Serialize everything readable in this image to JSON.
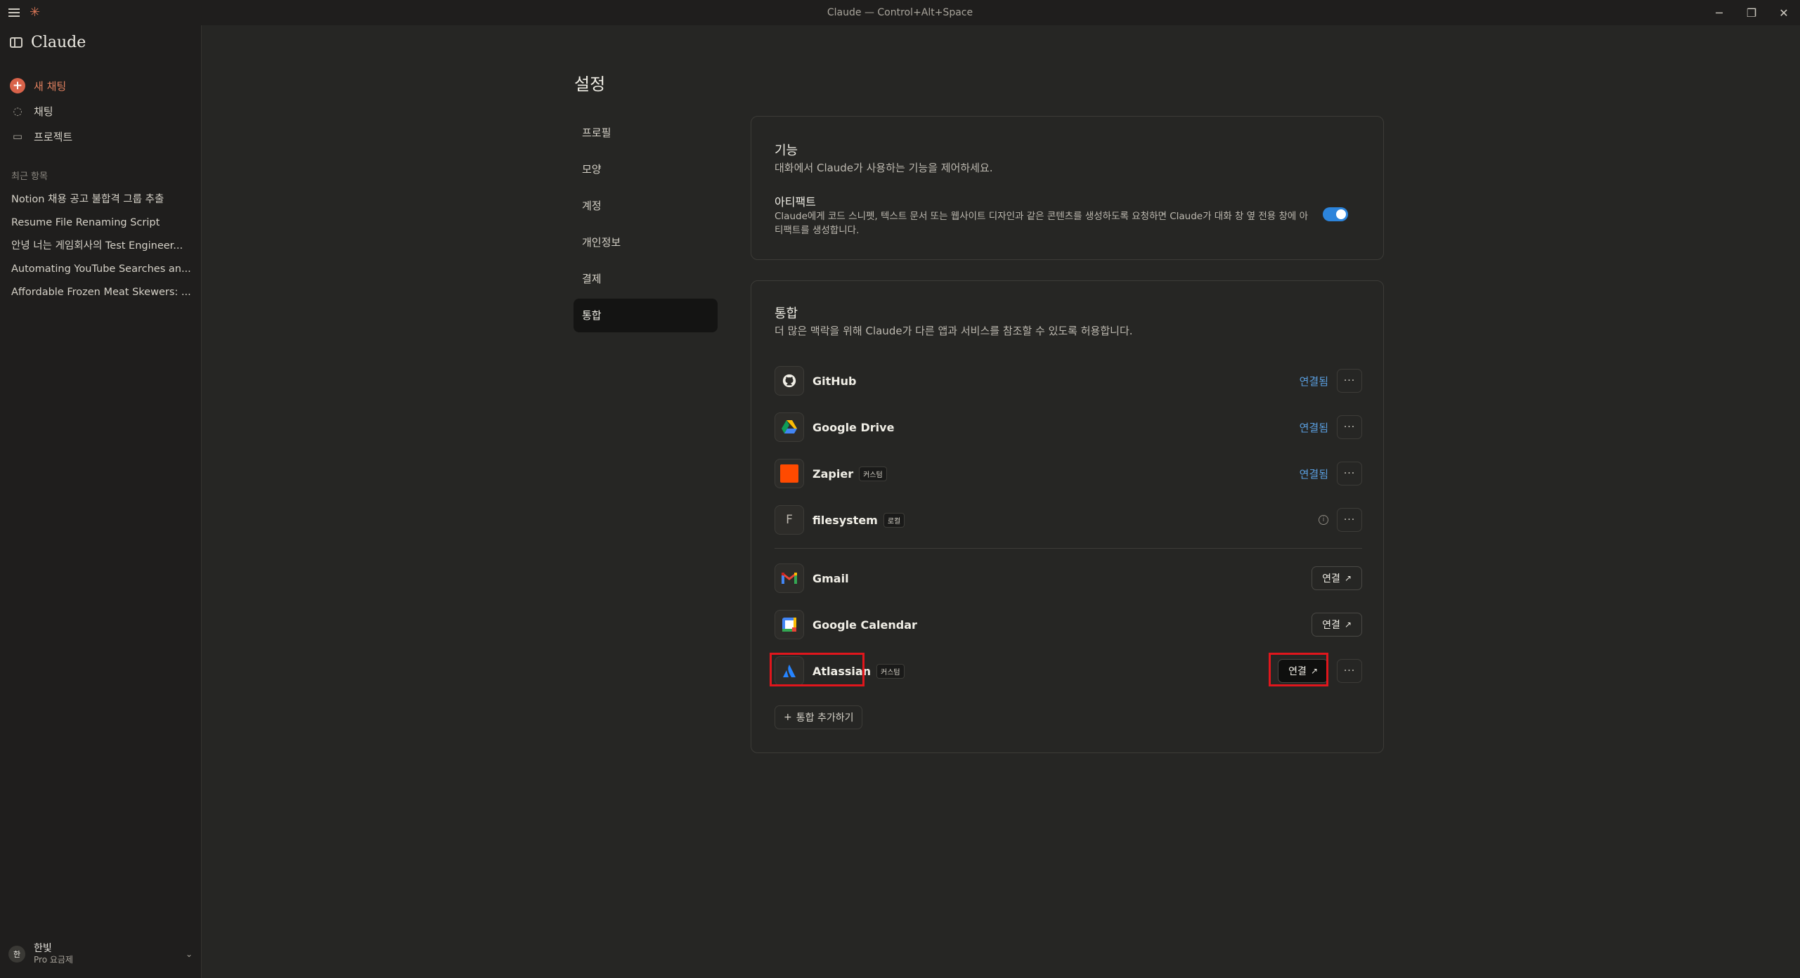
{
  "window": {
    "title": "Claude — Control+Alt+Space"
  },
  "sidebar": {
    "brand": "Claude",
    "new_chat": "새 채팅",
    "nav": [
      {
        "label": "채팅",
        "icon": "chat-icon"
      },
      {
        "label": "프로젝트",
        "icon": "folder-icon"
      }
    ],
    "recent_label": "최근 항목",
    "recent": [
      "Notion 채용 공고 불합격 그룹 추출",
      "Resume File Renaming Script",
      "안녕 너는 게임회사의 Test Engineer...",
      "Automating YouTube Searches an...",
      "Affordable Frozen Meat Skewers: ..."
    ],
    "user": {
      "initial": "한",
      "name": "한빛",
      "plan": "Pro 요금제"
    }
  },
  "settings": {
    "title": "설정",
    "nav": [
      "프로필",
      "모양",
      "계정",
      "개인정보",
      "결제",
      "통합"
    ],
    "active_nav": "통합"
  },
  "features": {
    "title": "기능",
    "subtitle": "대화에서 Claude가 사용하는 기능을 제어하세요.",
    "artifacts_title": "아티팩트",
    "artifacts_desc": "Claude에게 코드 스니펫, 텍스트 문서 또는 웹사이트 디자인과 같은 콘텐츠를 생성하도록 요청하면 Claude가 대화 창 옆 전용 창에 아티팩트를 생성합니다.",
    "artifacts_enabled": true
  },
  "integrations": {
    "title": "통합",
    "subtitle": "더 많은 맥락을 위해 Claude가 다른 앱과 서비스를 참조할 수 있도록 허용합니다.",
    "items": [
      {
        "name": "GitHub",
        "badge": "",
        "status": "연결됨",
        "icon": "github-icon"
      },
      {
        "name": "Google Drive",
        "badge": "",
        "status": "연결됨",
        "icon": "google-drive-icon"
      },
      {
        "name": "Zapier",
        "badge": "커스텀",
        "status": "연결됨",
        "icon": "zapier-icon"
      },
      {
        "name": "filesystem",
        "badge": "로컬",
        "status": "",
        "icon": "filesystem-icon",
        "icon_letter": "F"
      },
      {
        "name": "Gmail",
        "badge": "",
        "connect": "연결",
        "icon": "gmail-icon"
      },
      {
        "name": "Google Calendar",
        "badge": "",
        "connect": "연결",
        "icon": "google-calendar-icon"
      },
      {
        "name": "Atlassian",
        "badge": "커스텀",
        "connect": "연결",
        "icon": "atlassian-icon"
      }
    ],
    "add_label": "통합 추가하기",
    "dots": "···",
    "info": "i"
  },
  "colors": {
    "accent": "#d97757",
    "link": "#5a9fe0",
    "toggle": "#2c84db",
    "highlight": "#e0161c"
  }
}
